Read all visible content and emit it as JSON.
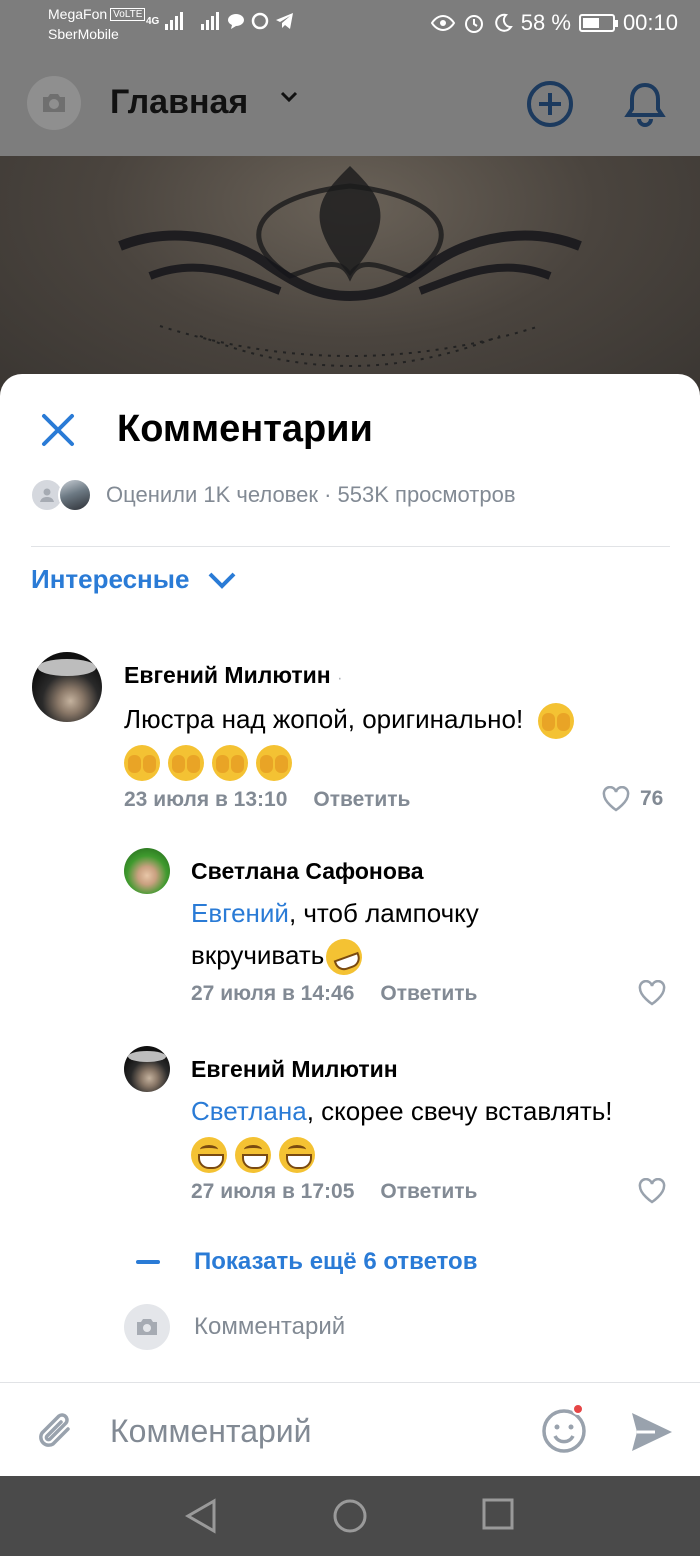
{
  "status_bar": {
    "carrier1": "MegaFon",
    "volte": "VoLTE",
    "network": "4G",
    "carrier2": "SberMobile",
    "battery": "58 %",
    "battery_level": 0.58,
    "time": "00:10"
  },
  "header": {
    "title": "Главная"
  },
  "comments_sheet": {
    "title": "Комментарии",
    "stats": "Оценили 1K человек · 553K просмотров",
    "sort_label": "Интересные",
    "accent_color": "#2a7bd6",
    "comments": [
      {
        "author": "Евгений Милютин",
        "author_suffix": "·",
        "text": "Люстра над жопой, оригинально!",
        "date": "23 июля в 13:10",
        "reply_label": "Ответить",
        "likes": "76"
      }
    ],
    "replies": [
      {
        "author": "Светлана Сафонова",
        "mention": "Евгений",
        "text": ", чтоб лампочку вкручивать",
        "date": "27 июля в 14:46",
        "reply_label": "Ответить"
      },
      {
        "author": "Евгений Милютин",
        "mention": "Светлана",
        "text": ", скорее свечу вставлять!",
        "date": "27 июля в 17:05",
        "reply_label": "Ответить"
      }
    ],
    "show_more_replies": "Показать ещё 6 ответов",
    "reply_placeholder": "Комментарий"
  },
  "compose": {
    "placeholder": "Комментарий"
  }
}
